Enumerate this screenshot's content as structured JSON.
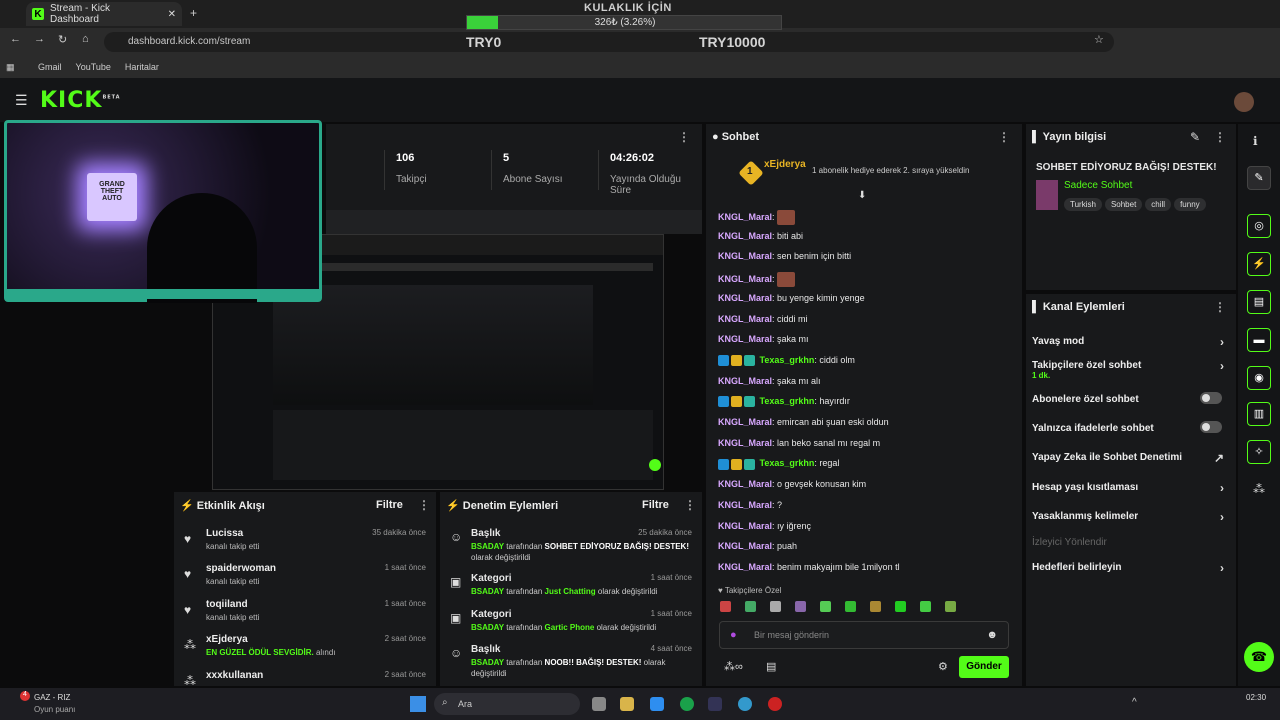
{
  "browser": {
    "tab_title": "Stream - Kick Dashboard",
    "url": "dashboard.kick.com/stream",
    "bookmarks": [
      "Gmail",
      "YouTube",
      "Haritalar"
    ]
  },
  "goal": {
    "title": "KULAKLIK İÇİN",
    "progress_text": "326₺ (3.26%)",
    "progress_fraction": 0.0326,
    "min": "TRY0",
    "max": "TRY10000",
    "fill_color": "#3ad13a"
  },
  "kick": {
    "logo": "KICK",
    "beta": "BETA",
    "accent": "#53fc18"
  },
  "stats": [
    {
      "value": "106",
      "label": "Takipçi"
    },
    {
      "value": "5",
      "label": "Abone Sayısı"
    },
    {
      "value": "04:26:02",
      "label": "Yayında Olduğu Süre"
    }
  ],
  "events": {
    "title": "Etkinlik Akışı",
    "filter": "Filtre",
    "items": [
      {
        "name": "Lucissa",
        "sub": "kanalı takip etti",
        "time": "35 dakika önce",
        "icon": "heart-icon"
      },
      {
        "name": "spaiderwoman",
        "sub": "kanalı takip etti",
        "time": "1 saat önce",
        "icon": "heart-icon"
      },
      {
        "name": "toqiiland",
        "sub": "kanalı takip etti",
        "time": "1 saat önce",
        "icon": "heart-icon"
      },
      {
        "name": "xEjderya",
        "sub_reward": "EN GÜZEL ÖDÜL SEVGİDİR.",
        "sub_tail": "alındı",
        "time": "2 saat önce",
        "icon": "points-icon"
      },
      {
        "name": "xxxkullanan",
        "time": "2 saat önce"
      }
    ]
  },
  "moderation": {
    "title": "Denetim Eylemleri",
    "filter": "Filtre",
    "items": [
      {
        "head": "Başlık",
        "actor": "BSADAY",
        "mid": "tarafından",
        "value": "SOHBET EDİYORUZ BAĞIŞ! DESTEK!",
        "tail": "olarak değiştirildi",
        "time": "25 dakika önce"
      },
      {
        "head": "Kategori",
        "actor": "BSADAY",
        "mid": "tarafından",
        "value": "Just Chatting",
        "tail": "olarak değiştirildi",
        "time": "1 saat önce"
      },
      {
        "head": "Kategori",
        "actor": "BSADAY",
        "mid": "tarafından",
        "value": "Gartic Phone",
        "tail": "olarak değiştirildi",
        "time": "1 saat önce"
      },
      {
        "head": "Başlık",
        "actor": "BSADAY",
        "mid": "tarafından",
        "value": "NOOB!! BAĞIŞ! DESTEK!",
        "tail": "olarak değiştirildi",
        "time": "4 saat önce"
      }
    ]
  },
  "chat": {
    "title": "Sohbet",
    "pinned_user": "xEjderya",
    "pinned_rank": "1",
    "pinned_text": "1 abonelik hediye ederek 2. sıraya yükseldin",
    "messages": [
      {
        "user": "KNGL_Maral",
        "text": "",
        "emote": true
      },
      {
        "user": "KNGL_Maral",
        "text": "biti abi"
      },
      {
        "user": "KNGL_Maral",
        "text": "sen benim için bitti"
      },
      {
        "user": "KNGL_Maral",
        "text": "",
        "emote": true
      },
      {
        "user": "KNGL_Maral",
        "text": "bu yenge kimin yenge"
      },
      {
        "user": "KNGL_Maral",
        "text": "ciddi mi"
      },
      {
        "user": "KNGL_Maral",
        "text": "şaka mı"
      },
      {
        "user": "Texas_grkhn",
        "text": "ciddi olm",
        "badges": true
      },
      {
        "user": "KNGL_Maral",
        "text": "şaka mı alı"
      },
      {
        "user": "Texas_grkhn",
        "text": "hayırdır",
        "badges": true
      },
      {
        "user": "KNGL_Maral",
        "text": "emircan abi şuan eski oldun"
      },
      {
        "user": "KNGL_Maral",
        "text": "lan beko sanal mı regal m"
      },
      {
        "user": "Texas_grkhn",
        "text": "regal",
        "badges": true
      },
      {
        "user": "KNGL_Maral",
        "text": "o gevşek konusan kim"
      },
      {
        "user": "KNGL_Maral",
        "text": "?"
      },
      {
        "user": "KNGL_Maral",
        "text": "ıy iğrenç"
      },
      {
        "user": "KNGL_Maral",
        "text": "puah"
      },
      {
        "user": "KNGL_Maral",
        "text": "benim makyajım bile 1milyon tl"
      }
    ],
    "followers_only": "Takipçilere Özel",
    "input_placeholder": "Bir mesaj gönderin",
    "send": "Gönder"
  },
  "info": {
    "title": "Yayın bilgisi",
    "stream_title": "SOHBET EDİYORUZ BAĞIŞ! DESTEK!",
    "category": "Sadece Sohbet",
    "tags": [
      "Turkish",
      "Sohbet",
      "chill",
      "funny"
    ]
  },
  "actions": {
    "title": "Kanal Eylemleri",
    "items": [
      {
        "label": "Yavaş mod",
        "kind": "chevron"
      },
      {
        "label": "Takipçilere özel sohbet",
        "sub": "1 dk.",
        "kind": "chevron"
      },
      {
        "label": "Abonelere özel sohbet",
        "kind": "toggle"
      },
      {
        "label": "Yalnızca ifadelerle sohbet",
        "kind": "toggle"
      },
      {
        "label": "Yapay Zeka ile Sohbet Denetimi",
        "kind": "external"
      },
      {
        "label": "Hesap yaşı kısıtlaması",
        "kind": "chevron"
      },
      {
        "label": "Yasaklanmış kelimeler",
        "kind": "chevron"
      },
      {
        "label": "İzleyici Yönlendir",
        "kind": "disabled"
      },
      {
        "label": "Hedefleri belirleyin",
        "kind": "chevron"
      }
    ]
  },
  "taskbar": {
    "weather_label": "GAZ - RIZ",
    "weather_sub": "Oyun puanı",
    "badge": "4",
    "search": "Ara",
    "time": "02:30"
  }
}
